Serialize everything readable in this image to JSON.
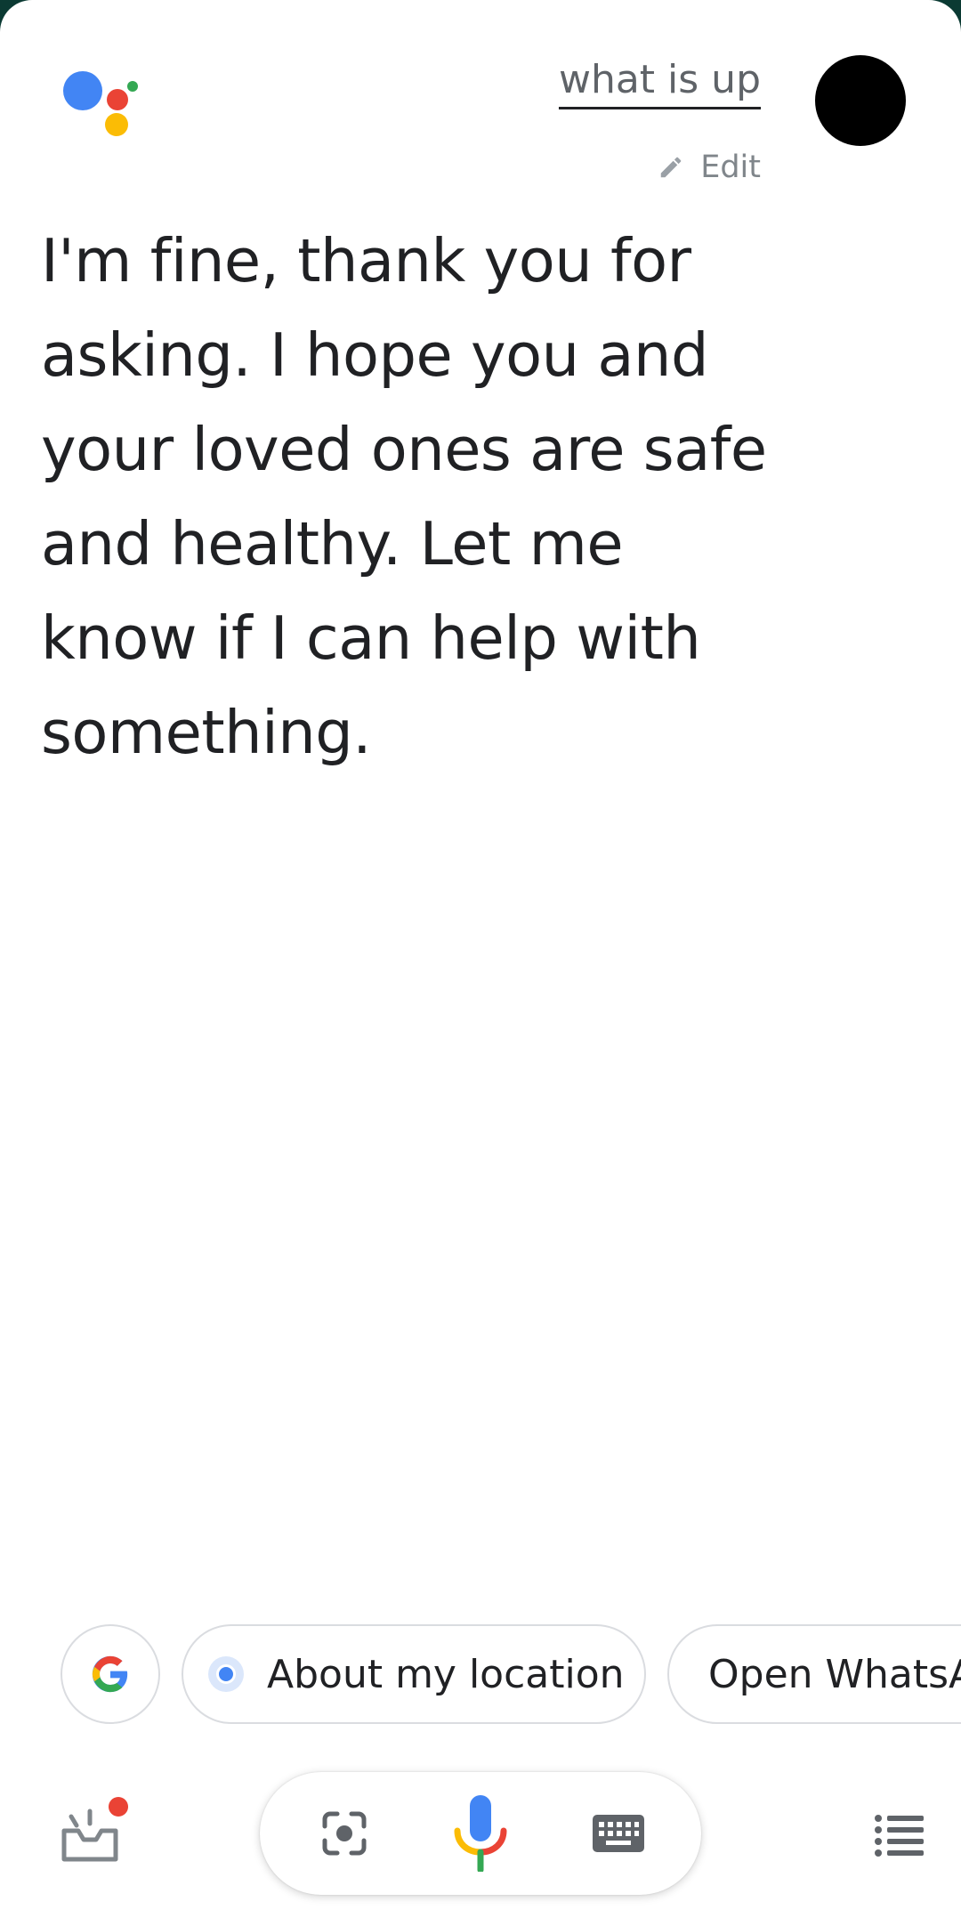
{
  "query": {
    "text": "what is up",
    "edit_label": "Edit"
  },
  "response": {
    "text": "I'm fine, thank you for asking. I hope you and your loved ones are safe and healthy. Let me know if I can help with something."
  },
  "suggestions": {
    "location_label": "About my location",
    "whatsapp_label": "Open WhatsApp"
  },
  "icons": {
    "logo": "google-assistant-logo",
    "edit": "pencil-icon",
    "google": "google-g-icon",
    "location": "location-dot-icon",
    "snapshot": "inbox-snapshot-icon",
    "lens": "lens-icon",
    "mic": "microphone-icon",
    "keyboard": "keyboard-icon",
    "list": "list-icon"
  },
  "colors": {
    "blue": "#4285f4",
    "red": "#ea4335",
    "yellow": "#fbbc05",
    "green": "#34a853",
    "text": "#202124",
    "secondary": "#5f6368"
  }
}
